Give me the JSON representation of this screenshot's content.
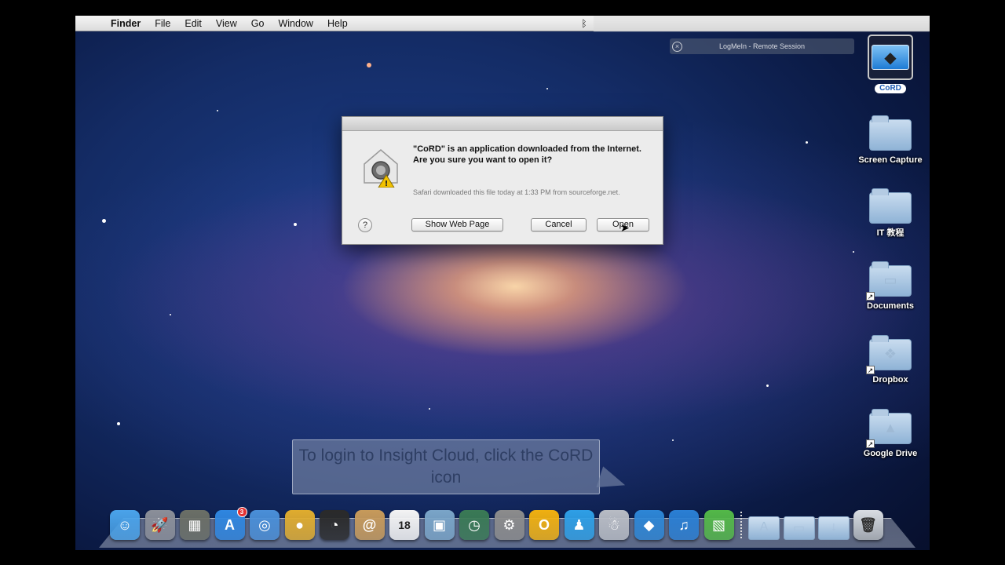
{
  "menubar": {
    "apple_icon": "",
    "items": [
      "Finder",
      "File",
      "Edit",
      "View",
      "Go",
      "Window",
      "Help"
    ],
    "bluetooth_icon": "ᛒ"
  },
  "logmein": {
    "title": "LogMeIn - Remote Session",
    "close_icon": "×"
  },
  "desktop_icons": [
    {
      "label": "CoRD",
      "kind": "app",
      "selected": true
    },
    {
      "label": "Screen Capture",
      "kind": "folder"
    },
    {
      "label": "IT 教程",
      "kind": "folder"
    },
    {
      "label": "Documents",
      "kind": "folder-alias"
    },
    {
      "label": "Dropbox",
      "kind": "folder-alias"
    },
    {
      "label": "Google Drive",
      "kind": "folder-alias"
    }
  ],
  "dialog": {
    "message": "\"CoRD\" is an application downloaded from the Internet. Are you sure you want to open it?",
    "detail": "Safari downloaded this file today at 1:33 PM from sourceforge.net.",
    "help_label": "?",
    "show_web_page_label": "Show Web Page",
    "cancel_label": "Cancel",
    "open_label": "Open"
  },
  "callout": {
    "text": "To login to Insight Cloud, click the CoRD icon"
  },
  "dock": {
    "apps": [
      {
        "name": "Finder",
        "glyph": "☺",
        "color": "#4aa3ea"
      },
      {
        "name": "Launchpad",
        "glyph": "🚀",
        "color": "#8b8f99"
      },
      {
        "name": "Image Capture",
        "glyph": "▦",
        "color": "#6b6f66"
      },
      {
        "name": "App Store",
        "glyph": "A",
        "color": "#2f86e0",
        "badge": "3"
      },
      {
        "name": "Safari",
        "glyph": "◎",
        "color": "#4a8fd8"
      },
      {
        "name": "Chrome",
        "glyph": "●",
        "color": "#e0ac2e"
      },
      {
        "name": "Dashboard",
        "glyph": "◔",
        "color": "#2a2a2a"
      },
      {
        "name": "Contacts",
        "glyph": "@",
        "color": "#c79a5a"
      },
      {
        "name": "Calendar",
        "glyph": "18",
        "color": "#f4f4f4"
      },
      {
        "name": "Preview",
        "glyph": "▣",
        "color": "#7aa5c8"
      },
      {
        "name": "Time Machine",
        "glyph": "◷",
        "color": "#3a7a55"
      },
      {
        "name": "System Preferences",
        "glyph": "⚙",
        "color": "#8c8c8c"
      },
      {
        "name": "Outlook",
        "glyph": "O",
        "color": "#f0b010"
      },
      {
        "name": "Messenger",
        "glyph": "♟",
        "color": "#2e9fe6"
      },
      {
        "name": "Automator",
        "glyph": "☃",
        "color": "#b8bcc4"
      },
      {
        "name": "CoRD",
        "glyph": "◆",
        "color": "#2d86d6"
      },
      {
        "name": "iTunes",
        "glyph": "♫",
        "color": "#2a7fd4"
      },
      {
        "name": "Archive Utility",
        "glyph": "▧",
        "color": "#53b848"
      }
    ],
    "folders": [
      {
        "name": "Applications",
        "glyph": "A"
      },
      {
        "name": "Documents",
        "glyph": "▭"
      },
      {
        "name": "Downloads",
        "glyph": "↓"
      }
    ],
    "trash": {
      "name": "Trash",
      "glyph": "🗑"
    }
  }
}
